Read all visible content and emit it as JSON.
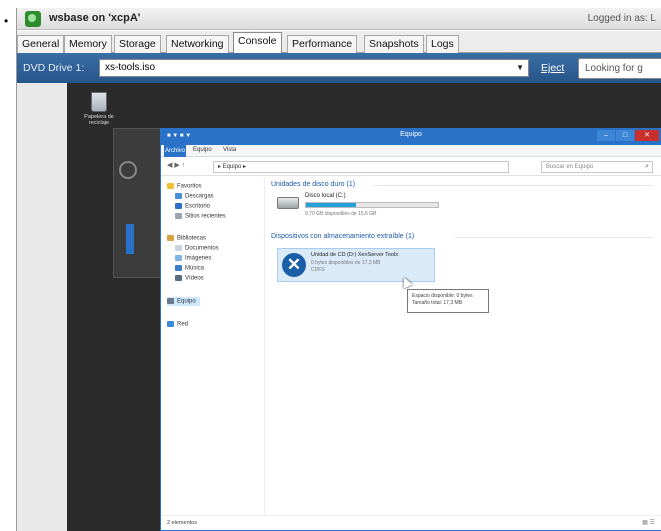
{
  "window": {
    "title": "wsbase on 'xcpA'",
    "logged_in": "Logged in as: L"
  },
  "tabs": [
    {
      "label": "General",
      "active": false
    },
    {
      "label": "Memory",
      "active": false
    },
    {
      "label": "Storage",
      "active": false
    },
    {
      "label": "Networking",
      "active": false
    },
    {
      "label": "Console",
      "active": true
    },
    {
      "label": "Performance",
      "active": false
    },
    {
      "label": "Snapshots",
      "active": false
    },
    {
      "label": "Logs",
      "active": false
    }
  ],
  "console_bar": {
    "dvd_label": "DVD Drive 1:",
    "dvd_value": "xs-tools.iso",
    "eject_label": "Eject",
    "looking_for": "Looking for g"
  },
  "vm_desktop": {
    "recycle_bin_label": "Papelera de reciclaje",
    "explorer": {
      "title": "Equipo",
      "ribbon_tabs": [
        "Archivo",
        "Equipo",
        "Vista"
      ],
      "address": "▸ Equipo ▸",
      "search_placeholder": "Buscar en Equipo",
      "nav": {
        "favorites": "Favoritos",
        "descargas": "Descargas",
        "escritorio": "Escritorio",
        "sitios_recientes": "Sitios recientes",
        "bibliotecas": "Bibliotecas",
        "documentos": "Documentos",
        "imagenes": "Imágenes",
        "musica": "Música",
        "videos": "Vídeos",
        "equipo": "Equipo",
        "red": "Red"
      },
      "group_hard_drives": "Unidades de disco duro (1)",
      "local_disk": {
        "name": "Disco local (C:)",
        "free": "9,70 GB disponibles de 15,6 GB",
        "used_fraction": 0.38
      },
      "group_removable": "Dispositivos con almacenamiento extraíble (1)",
      "dvd_drive": {
        "name": "Unidad de CD (D:) XenServer Tools",
        "free": "0 bytes disponibles de 17,3 MB",
        "fs": "CDFS"
      },
      "tooltip": {
        "line1": "Espacio disponible: 0 bytes",
        "line2": "Tamaño total: 17,3 MB"
      },
      "status": "2 elementos"
    }
  },
  "colors": {
    "console_bar": "#3a6ea5",
    "explorer_accent": "#2a72c8",
    "close_button": "#c9302c",
    "vm_desktop_bg": "#2b2b2b"
  }
}
